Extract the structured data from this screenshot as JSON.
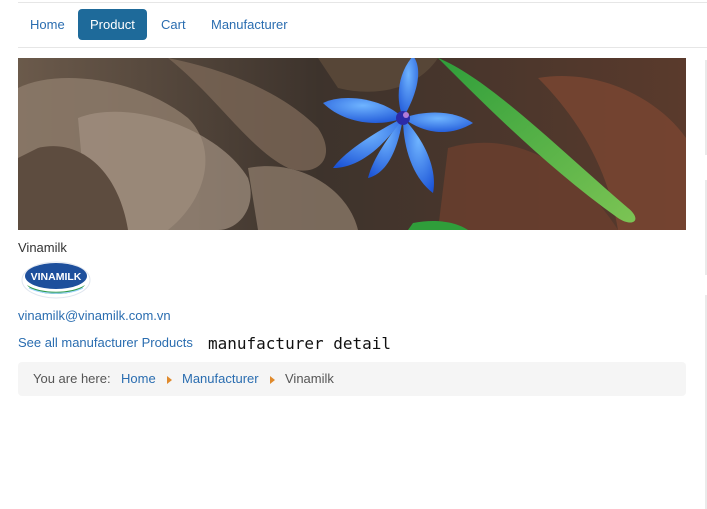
{
  "nav": {
    "items": [
      {
        "label": "Home",
        "active": false
      },
      {
        "label": "Product",
        "active": true
      },
      {
        "label": "Cart",
        "active": false
      },
      {
        "label": "Manufacturer",
        "active": false
      }
    ]
  },
  "manufacturer": {
    "name": "Vinamilk",
    "logo_text": "VINAMILK",
    "email": "vinamilk@vinamilk.com.vn",
    "see_all_label": "See all manufacturer Products",
    "detail_heading": "manufacturer detail"
  },
  "breadcrumb": {
    "lead": "You are here:",
    "items": [
      "Home",
      "Manufacturer",
      "Vinamilk"
    ]
  },
  "colors": {
    "link": "#2a6db0",
    "active_nav_bg": "#1e6a9a",
    "breadcrumb_separator": "#e08a2c",
    "logo_blue": "#1d4f9c",
    "logo_green": "#2e9a45"
  },
  "icons": {
    "breadcrumb_separator": "caret-right-icon"
  }
}
